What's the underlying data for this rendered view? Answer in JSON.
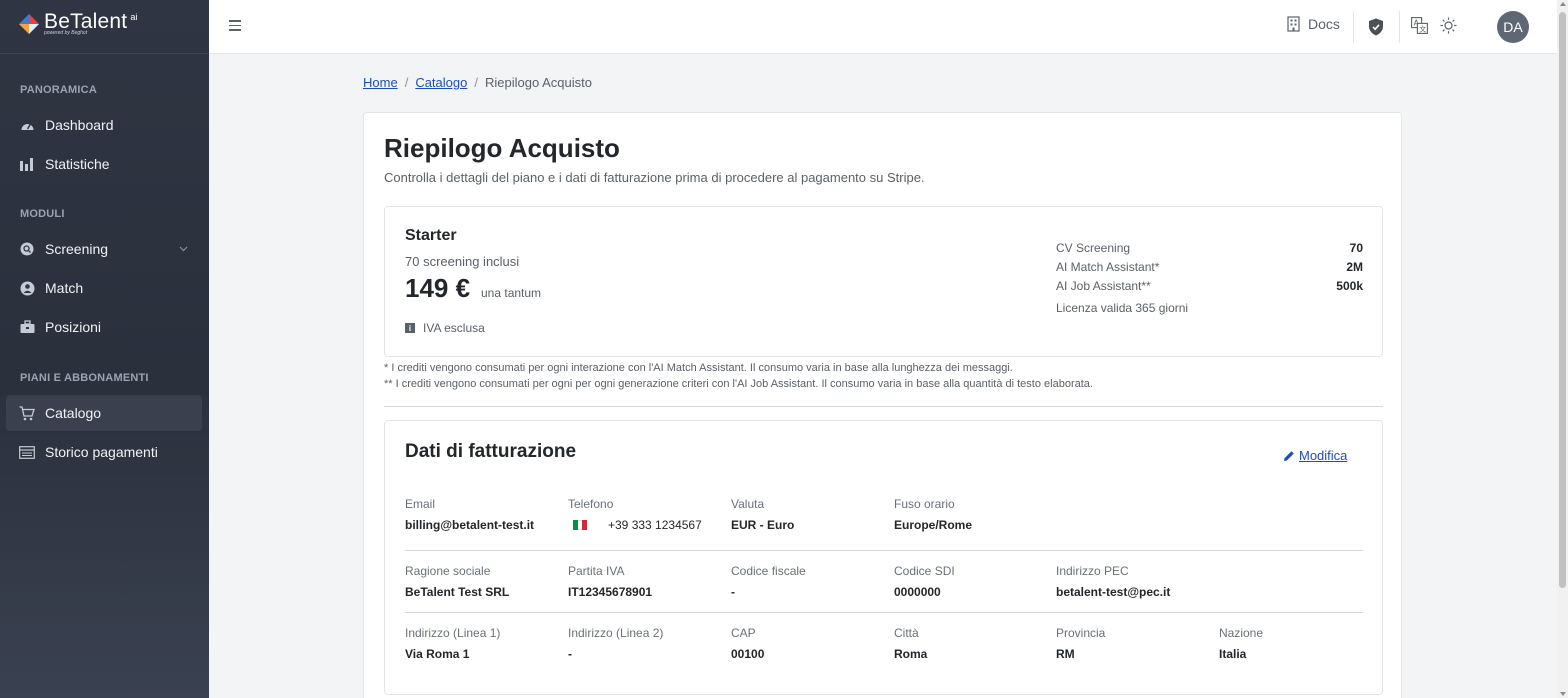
{
  "app": {
    "brand": "BeTalent",
    "brand_suffix": "ai",
    "brand_sub": "powered by Beghot"
  },
  "sidebar": {
    "sections": [
      {
        "title": "PANORAMICA"
      },
      {
        "title": "MODULI"
      },
      {
        "title": "PIANI E ABBONAMENTI"
      }
    ],
    "items": [
      {
        "label": "Dashboard",
        "icon": "gauge-icon"
      },
      {
        "label": "Statistiche",
        "icon": "bar-chart-icon"
      },
      {
        "label": "Screening",
        "icon": "search-doc-icon"
      },
      {
        "label": "Match",
        "icon": "user-icon"
      },
      {
        "label": "Posizioni",
        "icon": "briefcase-icon"
      },
      {
        "label": "Catalogo",
        "icon": "cart-icon",
        "active": true
      },
      {
        "label": "Storico pagamenti",
        "icon": "receipt-icon"
      }
    ]
  },
  "topbar": {
    "docs_label": "Docs",
    "avatar_initials": "DA"
  },
  "breadcrumb": {
    "home": "Home",
    "catalog": "Catalogo",
    "current": "Riepilogo Acquisto"
  },
  "page": {
    "title": "Riepilogo Acquisto",
    "subtitle": "Controlla i dettagli del piano e i dati di fatturazione prima di procedere al pagamento su Stripe."
  },
  "plan": {
    "name": "Starter",
    "included": "70 screening inclusi",
    "price": "149 €",
    "price_note": "una tantum",
    "vat_note": "IVA esclusa",
    "features": [
      {
        "label": "CV Screening",
        "value": "70"
      },
      {
        "label": "AI Match Assistant*",
        "value": "2M"
      },
      {
        "label": "AI Job Assistant**",
        "value": "500k"
      }
    ],
    "license": "Licenza valida 365 giorni"
  },
  "footnotes": [
    "* I crediti vengono consumati per ogni interazione con l'AI Match Assistant. Il consumo varia in base alla lunghezza dei messaggi.",
    "** I crediti vengono consumati per ogni per ogni generazione criteri con l'AI Job Assistant. Il consumo varia in base alla quantità di testo elaborata."
  ],
  "billing": {
    "title": "Dati di fatturazione",
    "edit_label": "Modifica",
    "email": {
      "label": "Email",
      "value": "billing@betalent-test.it"
    },
    "phone": {
      "label": "Telefono",
      "value": "+39 333 1234567"
    },
    "currency": {
      "label": "Valuta",
      "value": "EUR - Euro"
    },
    "timezone": {
      "label": "Fuso orario",
      "value": "Europe/Rome"
    },
    "company": {
      "label": "Ragione sociale",
      "value": "BeTalent Test SRL"
    },
    "vat_number": {
      "label": "Partita IVA",
      "value": "IT12345678901"
    },
    "tax_code": {
      "label": "Codice fiscale",
      "value": "-"
    },
    "sdi_code": {
      "label": "Codice SDI",
      "value": "0000000"
    },
    "pec": {
      "label": "Indirizzo PEC",
      "value": "betalent-test@pec.it"
    },
    "address1": {
      "label": "Indirizzo (Linea 1)",
      "value": "Via Roma 1"
    },
    "address2": {
      "label": "Indirizzo (Linea 2)",
      "value": "-"
    },
    "zip": {
      "label": "CAP",
      "value": "00100"
    },
    "city": {
      "label": "Città",
      "value": "Roma"
    },
    "province": {
      "label": "Provincia",
      "value": "RM"
    },
    "country": {
      "label": "Nazione",
      "value": "Italia"
    }
  },
  "colors": {
    "sidebar_bg": "#2f3542",
    "link": "#1f4db8",
    "flag_green": "#009246",
    "flag_white": "#ffffff",
    "flag_red": "#ce2b37"
  }
}
